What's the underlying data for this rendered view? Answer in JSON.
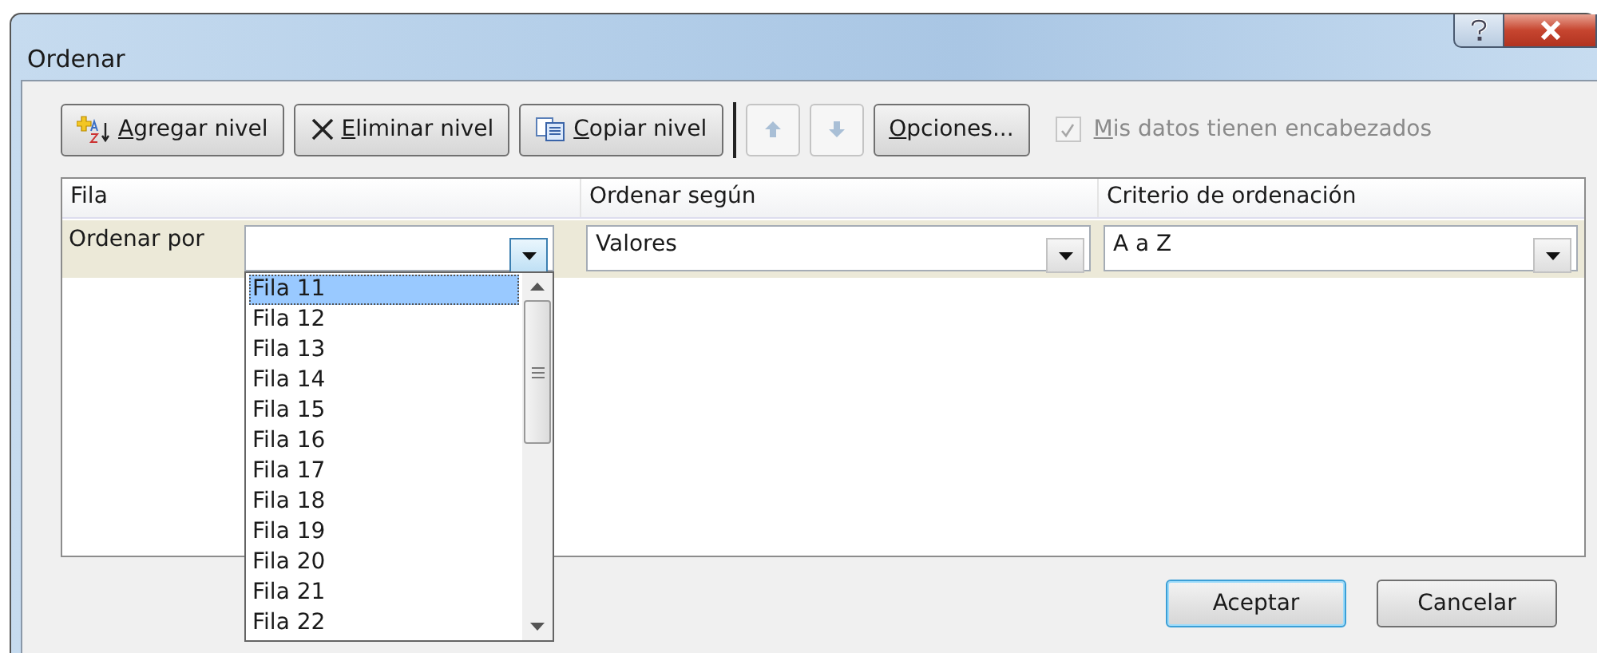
{
  "window": {
    "title": "Ordenar"
  },
  "toolbar": {
    "buttons": [
      {
        "kind": "add",
        "label": "Agregar nivel",
        "underline_first": true,
        "disabled": false
      },
      {
        "kind": "delete",
        "label": "Eliminar nivel",
        "underline_first": true,
        "disabled": false
      },
      {
        "kind": "copy",
        "label": "Copiar nivel",
        "underline_first": true,
        "disabled": false
      },
      {
        "kind": "up",
        "disabled": true
      },
      {
        "kind": "down",
        "disabled": true
      },
      {
        "kind": "text",
        "label": "Opciones...",
        "underline_first": true,
        "disabled": false
      }
    ],
    "header_checkbox": {
      "label": "Mis datos tienen encabezados",
      "underline_first": true,
      "checked": true,
      "disabled": true
    }
  },
  "grid": {
    "columns": [
      "Fila",
      "Ordenar según",
      "Criterio de ordenación"
    ],
    "rows": [
      {
        "label": "Ordenar por",
        "column_by": "",
        "sort_on": "Valores",
        "order": "A a Z"
      }
    ]
  },
  "dropdown_list": {
    "items": [
      {
        "label": "Fila 11",
        "selected": true
      },
      {
        "label": "Fila 12",
        "selected": false
      },
      {
        "label": "Fila 13",
        "selected": false
      },
      {
        "label": "Fila 14",
        "selected": false
      },
      {
        "label": "Fila 15",
        "selected": false
      },
      {
        "label": "Fila 16",
        "selected": false
      },
      {
        "label": "Fila 17",
        "selected": false
      },
      {
        "label": "Fila 18",
        "selected": false
      },
      {
        "label": "Fila 19",
        "selected": false
      },
      {
        "label": "Fila 20",
        "selected": false
      },
      {
        "label": "Fila 21",
        "selected": false
      },
      {
        "label": "Fila 22",
        "selected": false
      }
    ]
  },
  "buttons": [
    {
      "label": "Aceptar",
      "default": true
    },
    {
      "label": "Cancelar",
      "default": false
    }
  ]
}
